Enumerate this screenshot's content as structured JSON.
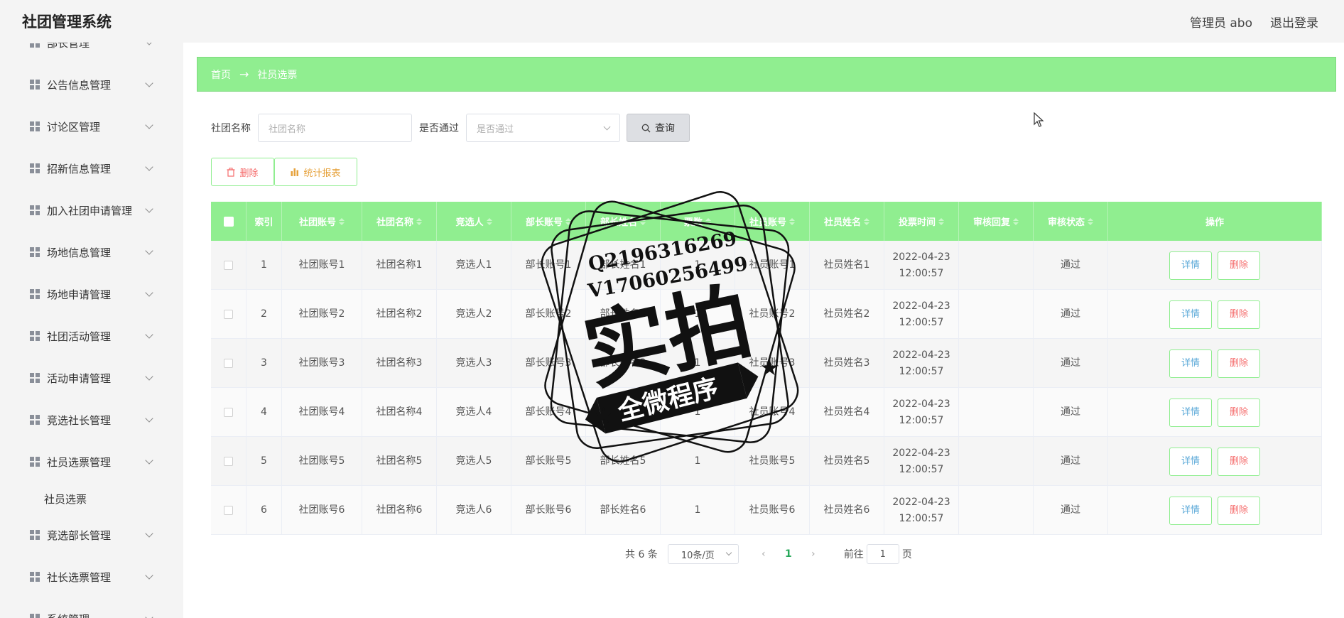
{
  "app": {
    "title": "社团管理系统"
  },
  "header": {
    "user_label": "管理员 abo",
    "logout_label": "退出登录"
  },
  "sidebar": {
    "items": [
      {
        "label": "部长管理",
        "icon": "grid-icon"
      },
      {
        "label": "公告信息管理",
        "icon": "grid-icon"
      },
      {
        "label": "讨论区管理",
        "icon": "monitor-icon"
      },
      {
        "label": "招新信息管理",
        "icon": "grid-icon"
      },
      {
        "label": "加入社团申请管理",
        "icon": "bulb-icon"
      },
      {
        "label": "场地信息管理",
        "icon": "grid-icon"
      },
      {
        "label": "场地申请管理",
        "icon": "grid-icon"
      },
      {
        "label": "社团活动管理",
        "icon": "grid-icon"
      },
      {
        "label": "活动申请管理",
        "icon": "clipboard-icon"
      },
      {
        "label": "竞选社长管理",
        "icon": "stamp-icon"
      },
      {
        "label": "社员选票管理",
        "icon": "grid-icon"
      },
      {
        "label": "竞选部长管理",
        "icon": "grid-icon"
      },
      {
        "label": "社长选票管理",
        "icon": "send-icon"
      },
      {
        "label": "系统管理",
        "icon": "grid-icon"
      }
    ],
    "sub_item": "社员选票"
  },
  "breadcrumb": {
    "home": "首页",
    "current": "社员选票"
  },
  "search": {
    "club_name_label": "社团名称",
    "club_name_placeholder": "社团名称",
    "passed_label": "是否通过",
    "passed_placeholder": "是否通过",
    "query_button": "查询"
  },
  "actions": {
    "delete_label": "删除",
    "stats_label": "统计报表"
  },
  "table": {
    "headers": [
      "索引",
      "社团账号",
      "社团名称",
      "竞选人",
      "部长账号",
      "部长姓名",
      "票数",
      "社员账号",
      "社员姓名",
      "投票时间",
      "审核回复",
      "审核状态",
      "操作"
    ],
    "rows": [
      {
        "idx": "1",
        "club_acct": "社团账号1",
        "club_name": "社团名称1",
        "candidate": "竞选人1",
        "min_acct": "部长账号1",
        "min_name": "部长姓名1",
        "votes": "1",
        "mem_acct": "社员账号1",
        "mem_name": "社员姓名1",
        "date": "2022-04-23",
        "time": "12:00:57",
        "reply": "",
        "status": "通过"
      },
      {
        "idx": "2",
        "club_acct": "社团账号2",
        "club_name": "社团名称2",
        "candidate": "竞选人2",
        "min_acct": "部长账号2",
        "min_name": "部长姓名2",
        "votes": "1",
        "mem_acct": "社员账号2",
        "mem_name": "社员姓名2",
        "date": "2022-04-23",
        "time": "12:00:57",
        "reply": "",
        "status": "通过"
      },
      {
        "idx": "3",
        "club_acct": "社团账号3",
        "club_name": "社团名称3",
        "candidate": "竞选人3",
        "min_acct": "部长账号3",
        "min_name": "部长姓名3",
        "votes": "1",
        "mem_acct": "社员账号3",
        "mem_name": "社员姓名3",
        "date": "2022-04-23",
        "time": "12:00:57",
        "reply": "",
        "status": "通过"
      },
      {
        "idx": "4",
        "club_acct": "社团账号4",
        "club_name": "社团名称4",
        "candidate": "竞选人4",
        "min_acct": "部长账号4",
        "min_name": "部长姓名4",
        "votes": "1",
        "mem_acct": "社员账号4",
        "mem_name": "社员姓名4",
        "date": "2022-04-23",
        "time": "12:00:57",
        "reply": "",
        "status": "通过"
      },
      {
        "idx": "5",
        "club_acct": "社团账号5",
        "club_name": "社团名称5",
        "candidate": "竞选人5",
        "min_acct": "部长账号5",
        "min_name": "部长姓名5",
        "votes": "1",
        "mem_acct": "社员账号5",
        "mem_name": "社员姓名5",
        "date": "2022-04-23",
        "time": "12:00:57",
        "reply": "",
        "status": "通过"
      },
      {
        "idx": "6",
        "club_acct": "社团账号6",
        "club_name": "社团名称6",
        "candidate": "竞选人6",
        "min_acct": "部长账号6",
        "min_name": "部长姓名6",
        "votes": "1",
        "mem_acct": "社员账号6",
        "mem_name": "社员姓名6",
        "date": "2022-04-23",
        "time": "12:00:57",
        "reply": "",
        "status": "通过"
      }
    ],
    "row_actions": {
      "detail": "详情",
      "delete": "删除"
    }
  },
  "pagination": {
    "total": "共 6 条",
    "page_size": "10条/页",
    "current_page": "1",
    "goto_label": "前往",
    "goto_value": "1",
    "page_suffix": "页"
  },
  "watermark": {
    "line1": "Q2196316269",
    "line2": "V17060256499",
    "main": "实拍",
    "ribbon": "全微程序"
  },
  "colors": {
    "accent": "#90ee90",
    "danger": "#f56c6c",
    "warning": "#e6a23c",
    "link": "#5aa8d8"
  }
}
